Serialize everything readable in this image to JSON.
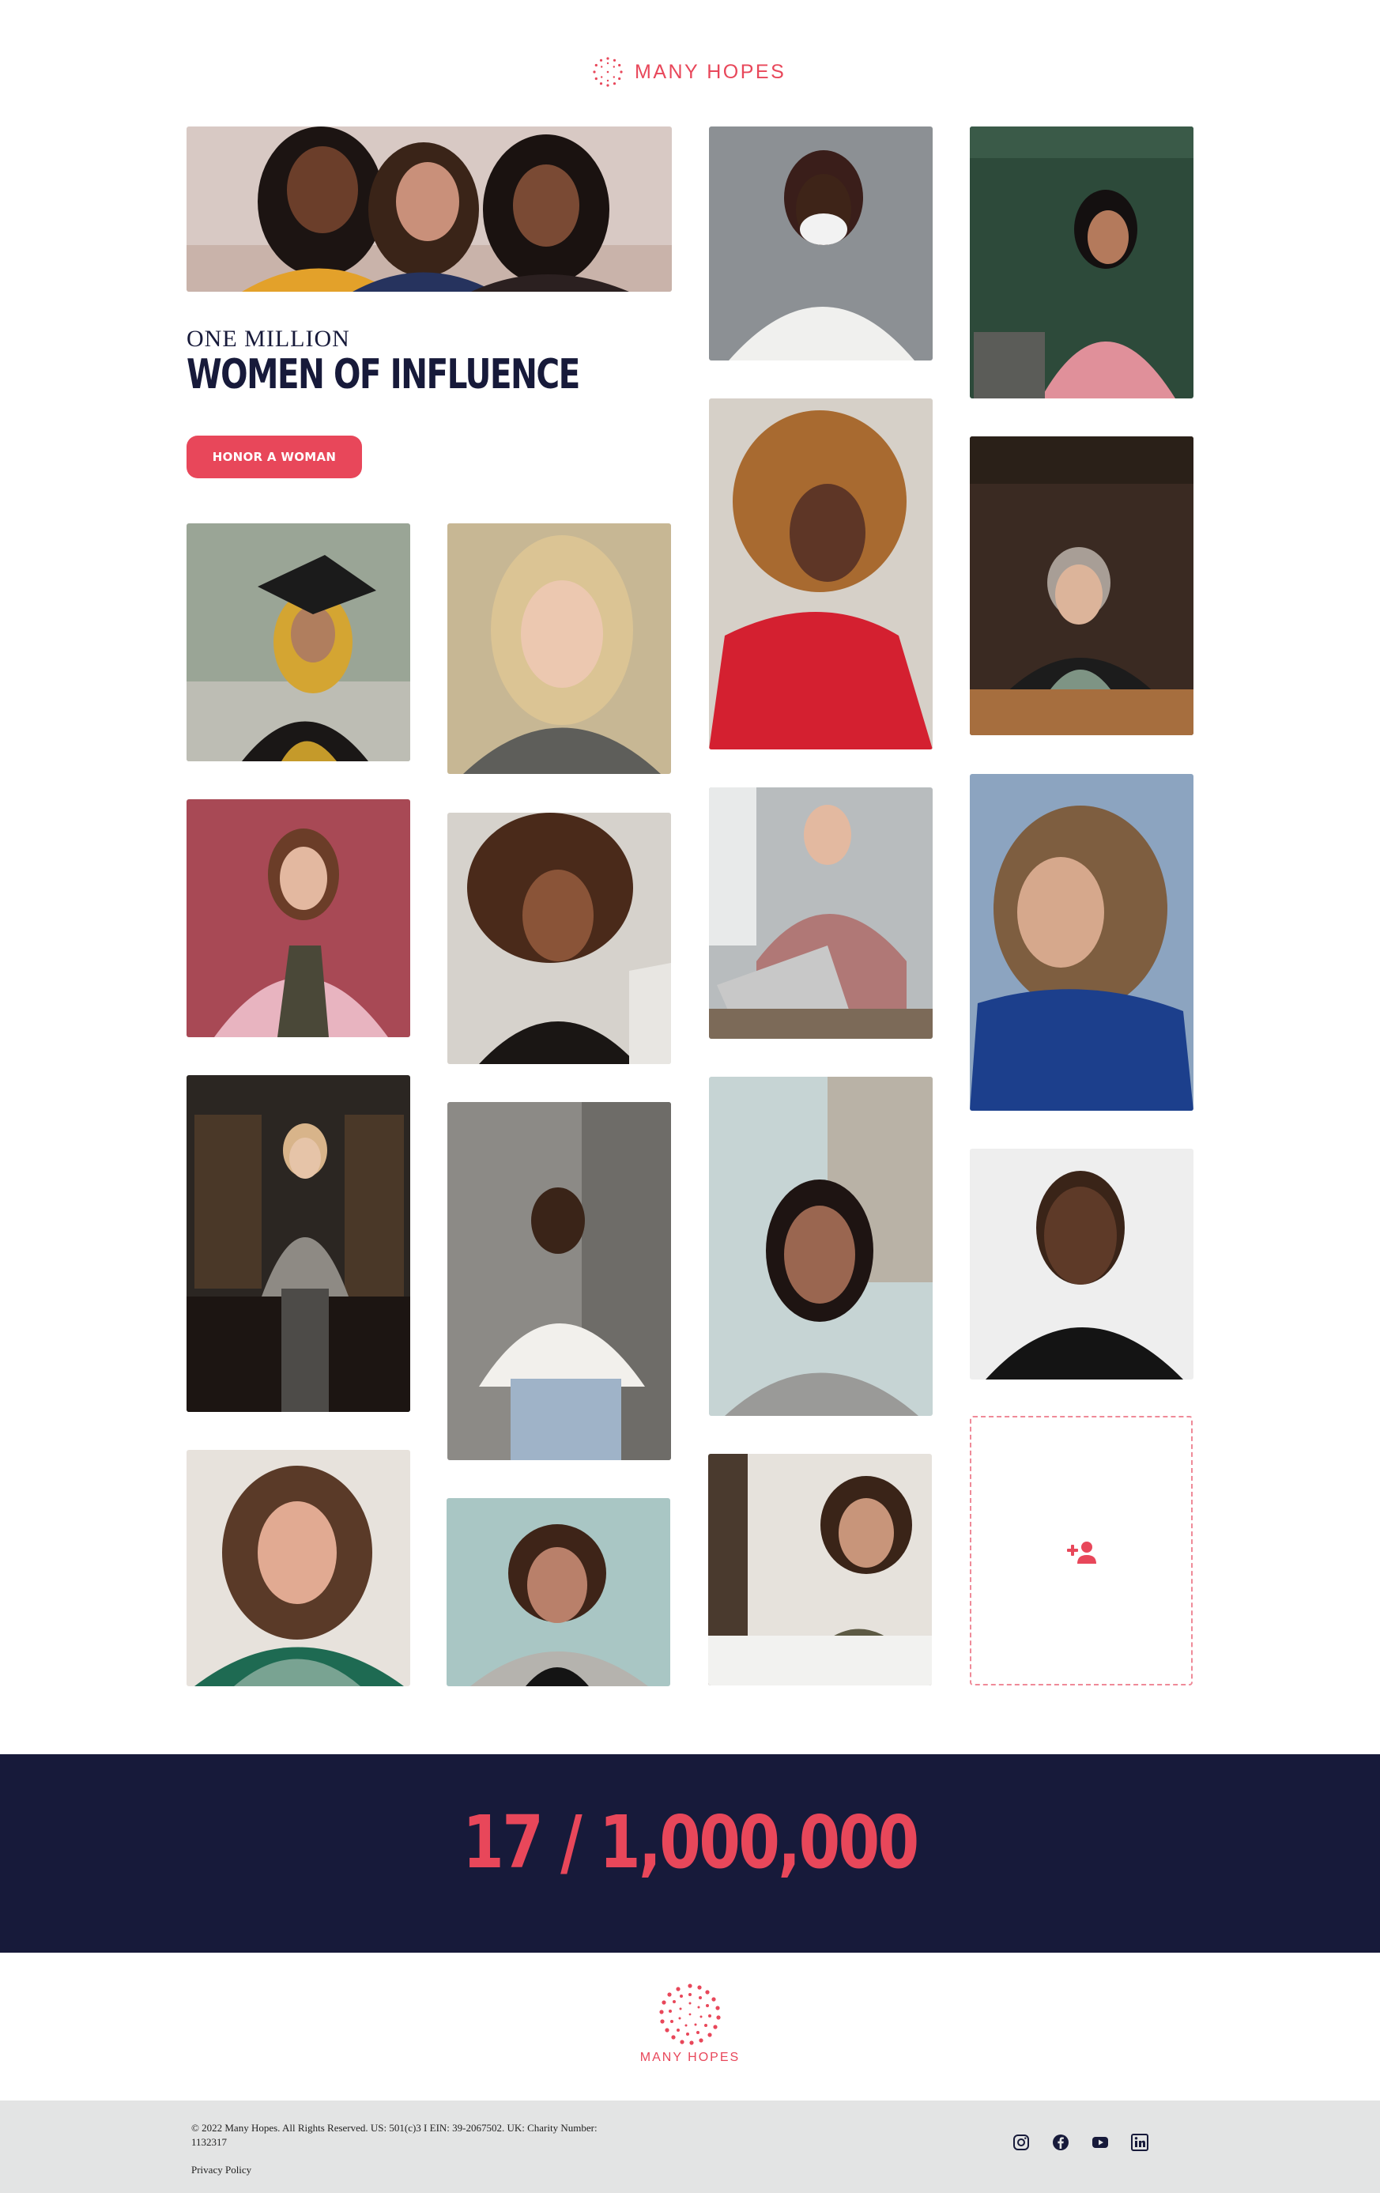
{
  "header": {
    "brand": "MANY HOPES"
  },
  "hero": {
    "kicker": "ONE MILLION",
    "headline": "WOMEN OF INFLUENCE",
    "cta_label": "HONOR A WOMAN"
  },
  "gallery": {
    "add_tile_icon": "person-add-icon"
  },
  "counter": {
    "text": "17 / 1,000,000"
  },
  "footer": {
    "brand": "MANY HOPES",
    "legal": "© 2022 Many Hopes. All Rights Reserved. US: 501(c)3 I EIN: 39-2067502. UK: Charity Number: 1132317",
    "privacy": "Privacy Policy",
    "socials": [
      "instagram-icon",
      "facebook-icon",
      "youtube-icon",
      "linkedin-icon"
    ]
  },
  "colors": {
    "accent": "#e8475a",
    "navy": "#171a3a",
    "footer_bg": "#e3e4e4"
  }
}
